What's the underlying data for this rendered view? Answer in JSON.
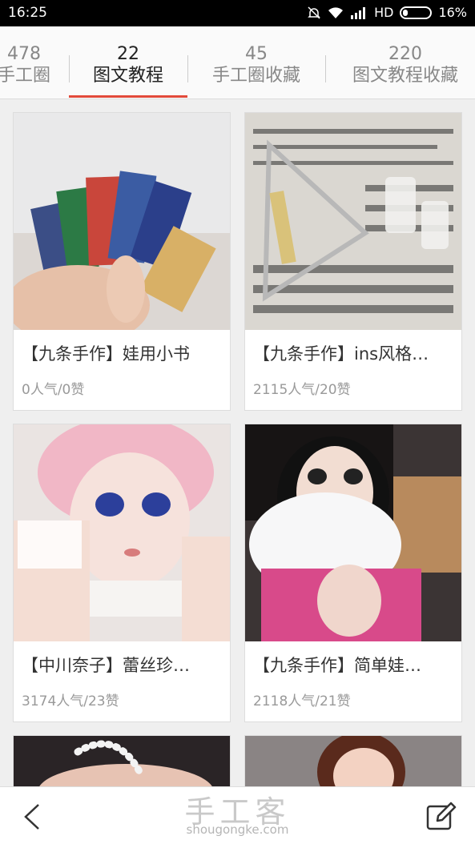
{
  "status": {
    "time": "16:25",
    "network": "HD",
    "battery": "16%"
  },
  "tabs": [
    {
      "count": "478",
      "label": "手工圈"
    },
    {
      "count": "22",
      "label": "图文教程"
    },
    {
      "count": "45",
      "label": "手工圈收藏"
    },
    {
      "count": "220",
      "label": "图文教程收藏"
    }
  ],
  "cards": [
    {
      "title": "【九条手作】娃用小书",
      "meta": "0人气/0赞"
    },
    {
      "title": "【九条手作】ins风格…",
      "meta": "2115人气/20赞"
    },
    {
      "title": "【中川奈子】蕾丝珍…",
      "meta": "3174人气/23赞"
    },
    {
      "title": "【九条手作】简单娃…",
      "meta": "2118人气/21赞"
    }
  ],
  "footer": {
    "brand_cn": "手工客",
    "brand_en": "shougongke.com"
  },
  "colors": {
    "accent": "#e24a3b"
  }
}
